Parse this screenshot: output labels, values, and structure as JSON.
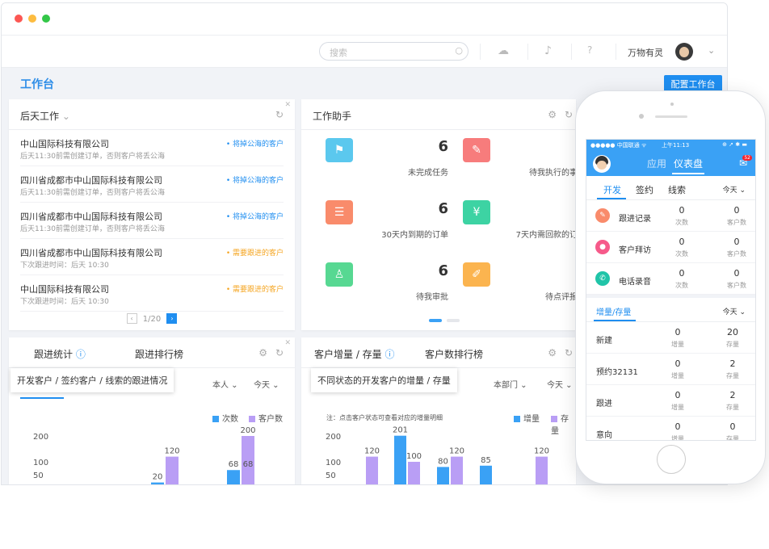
{
  "topbar": {
    "search_placeholder": "搜索",
    "username": "万物有灵"
  },
  "page": {
    "title": "工作台",
    "config_button": "配置工作台"
  },
  "card_followup": {
    "title": "后天工作",
    "items": [
      {
        "company": "中山国际科技有限公司",
        "desc": "后天11:30前需创建订单，否则客户将丢公海",
        "tag": "• 将掉公海的客户",
        "tag_color": "#1f8ef0"
      },
      {
        "company": "四川省成都市中山国际科技有限公司",
        "desc": "后天11:30前需创建订单，否则客户将丢公海",
        "tag": "• 将掉公海的客户",
        "tag_color": "#1f8ef0"
      },
      {
        "company": "四川省成都市中山国际科技有限公司",
        "desc": "后天11:30前需创建订单，否则客户将丢公海",
        "tag": "• 将掉公海的客户",
        "tag_color": "#1f8ef0"
      },
      {
        "company": "四川省成都市中山国际科技有限公司",
        "desc": "下次跟进时间：后天 10:30",
        "tag": "• 需要跟进的客户",
        "tag_color": "#f5a623"
      },
      {
        "company": "中山国际科技有限公司",
        "desc": "下次跟进时间：后天 10:30",
        "tag": "• 需要跟进的客户",
        "tag_color": "#f5a623"
      }
    ],
    "pager": "1/20"
  },
  "card_assistant": {
    "title": "工作助手",
    "tiles": [
      {
        "num": "6",
        "label": "未完成任务",
        "color": "#5bc8ee",
        "icon": "flag-icon",
        "glyph": "⚑"
      },
      {
        "num": "6",
        "label": "待我执行的事件",
        "color": "#f77c7c",
        "icon": "pin-icon",
        "glyph": "✎"
      },
      {
        "num": "6",
        "label": "30天内到期的订单",
        "color": "#f98b6b",
        "icon": "document-icon",
        "glyph": "☰"
      },
      {
        "num": "6",
        "label": "7天内需回款的订单",
        "color": "#3dd3a3",
        "icon": "yen-icon",
        "glyph": "¥"
      },
      {
        "num": "6",
        "label": "待我审批",
        "color": "#57d892",
        "icon": "stamp-icon",
        "glyph": "♙"
      },
      {
        "num": "6",
        "label": "待点评报告",
        "color": "#fbb44f",
        "icon": "report-icon",
        "glyph": "✐"
      }
    ]
  },
  "card_stats": {
    "tab1": "跟进统计",
    "tab2": "跟进排行榜",
    "hint": "开发客户 / 签约客户 / 线索的跟进情况",
    "filter1": "本人",
    "filter2": "今天",
    "legend": [
      "次数",
      "客户数"
    ]
  },
  "card_customers": {
    "tab1": "客户增量 / 存量",
    "tab2": "客户数排行榜",
    "hint": "不同状态的开发客户的增量 / 存量",
    "filter1": "本部门",
    "filter2": "今天",
    "note": "注：点击客户状态可查看对应的增量明细",
    "legend": [
      "增量",
      "存量"
    ]
  },
  "chart_data": [
    {
      "type": "bar",
      "ylim": [
        50,
        200
      ],
      "ticks": [
        200,
        100,
        50
      ],
      "series": [
        {
          "name": "次数",
          "values": [
            null,
            20,
            68,
            null
          ],
          "color": "#3aa1f5"
        },
        {
          "name": "客户数",
          "values": [
            null,
            120,
            200,
            68
          ],
          "color": "#b99ef5"
        }
      ],
      "labels": [
        "",
        "120",
        "68",
        "200",
        "68"
      ]
    },
    {
      "type": "bar",
      "ylim": [
        50,
        200
      ],
      "ticks": [
        200,
        100,
        50
      ],
      "series": [
        {
          "name": "增量",
          "values": [
            null,
            201,
            80,
            85,
            null
          ],
          "color": "#3aa1f5"
        },
        {
          "name": "存量",
          "values": [
            120,
            100,
            120,
            null,
            120
          ],
          "color": "#b99ef5"
        }
      ]
    }
  ],
  "phone": {
    "status_left": "●●●●● 中国联通 ᯤ",
    "status_time": "上午11:13",
    "tab_app": "应用",
    "tab_dash": "仪表盘",
    "badge": "52",
    "sub_tabs": [
      "开发",
      "签约",
      "线索"
    ],
    "period": "今天 ⌄",
    "rows": [
      {
        "label": "跟进记录",
        "n1": "0",
        "s1": "次数",
        "n2": "0",
        "s2": "客户数",
        "color": "#f98b6b"
      },
      {
        "label": "客户拜访",
        "n1": "0",
        "s1": "次数",
        "n2": "0",
        "s2": "客户数",
        "color": "#f65a8a"
      },
      {
        "label": "电话录音",
        "n1": "0",
        "s1": "次数",
        "n2": "0",
        "s2": "客户数",
        "color": "#20c4a8"
      }
    ],
    "section": "增量/存量",
    "section_period": "今天 ⌄",
    "rows2": [
      {
        "label": "新建",
        "n1": "0",
        "s1": "增量",
        "n2": "20",
        "s2": "存量"
      },
      {
        "label": "预约32131",
        "n1": "0",
        "s1": "增量",
        "n2": "2",
        "s2": "存量"
      },
      {
        "label": "跟进",
        "n1": "0",
        "s1": "增量",
        "n2": "2",
        "s2": "存量"
      },
      {
        "label": "意向",
        "n1": "0",
        "s1": "增量",
        "n2": "0",
        "s2": "存量"
      }
    ]
  }
}
